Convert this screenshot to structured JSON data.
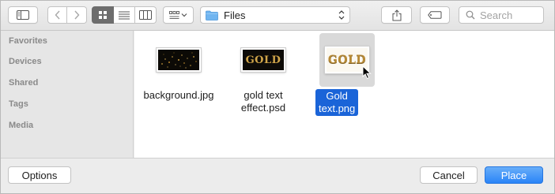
{
  "toolbar": {
    "path": {
      "label": "Files",
      "icon": "folder-icon"
    },
    "search": {
      "placeholder": "Search"
    },
    "icons": {
      "sidebar_toggle": "sidebar-toggle-icon",
      "back": "chevron-left-icon",
      "forward": "chevron-right-icon",
      "icon_view": "grid-view-icon",
      "list_view": "list-view-icon",
      "column_view": "column-view-icon",
      "arrange": "arrange-icon",
      "share": "share-icon",
      "tag": "tag-icon"
    }
  },
  "sidebar": {
    "items": [
      {
        "label": "Favorites"
      },
      {
        "label": "Devices"
      },
      {
        "label": "Shared"
      },
      {
        "label": "Tags"
      },
      {
        "label": "Media"
      }
    ]
  },
  "files": [
    {
      "name": "background.jpg",
      "selected": false,
      "thumb_text": ""
    },
    {
      "name_line1": "gold text",
      "name_line2": "effect.psd",
      "selected": false,
      "thumb_text": "GOLD"
    },
    {
      "name": "Gold text.png",
      "selected": true,
      "thumb_text": "GOLD"
    }
  ],
  "footer": {
    "options_label": "Options",
    "cancel_label": "Cancel",
    "place_label": "Place"
  },
  "colors": {
    "selection": "#1a64d8",
    "primary_button": "#2a84f7",
    "gold": "#c9a24a"
  }
}
